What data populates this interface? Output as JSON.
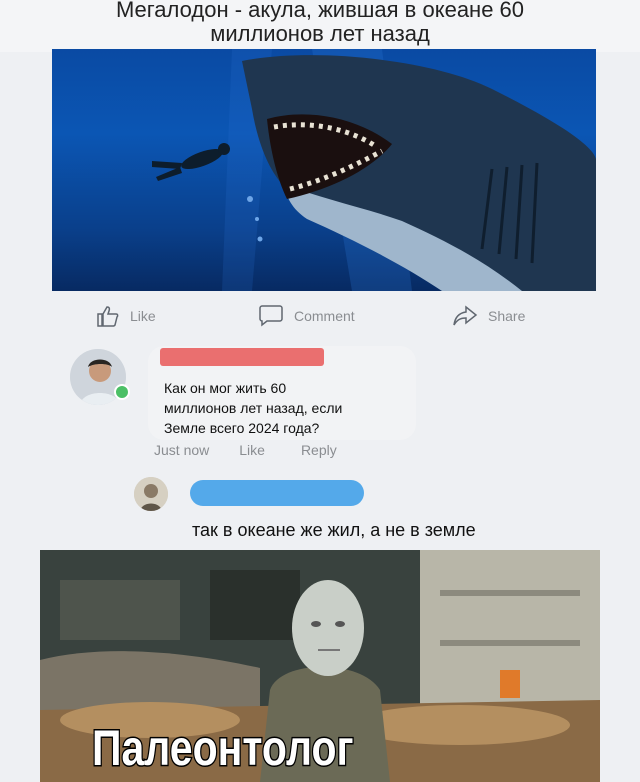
{
  "caption": {
    "line1": "Мегалодон - акула, жившая в океане 60",
    "line2": "миллионов лет назад"
  },
  "actions": {
    "like": "Like",
    "comment": "Comment",
    "share": "Share"
  },
  "comment1": {
    "text": "Как он мог жить 60\nмиллионов лет назад, если\nЗемле всего 2024 года?",
    "time": "Just now",
    "like": "Like",
    "reply": "Reply"
  },
  "comment2": {
    "text": "так в океане же жил, а не в земле"
  },
  "meme": {
    "caption": "Палеонтолог"
  },
  "colors": {
    "redaction_red": "#ea6f6f",
    "redaction_blue": "#54a9ea",
    "online": "#4cc066"
  }
}
